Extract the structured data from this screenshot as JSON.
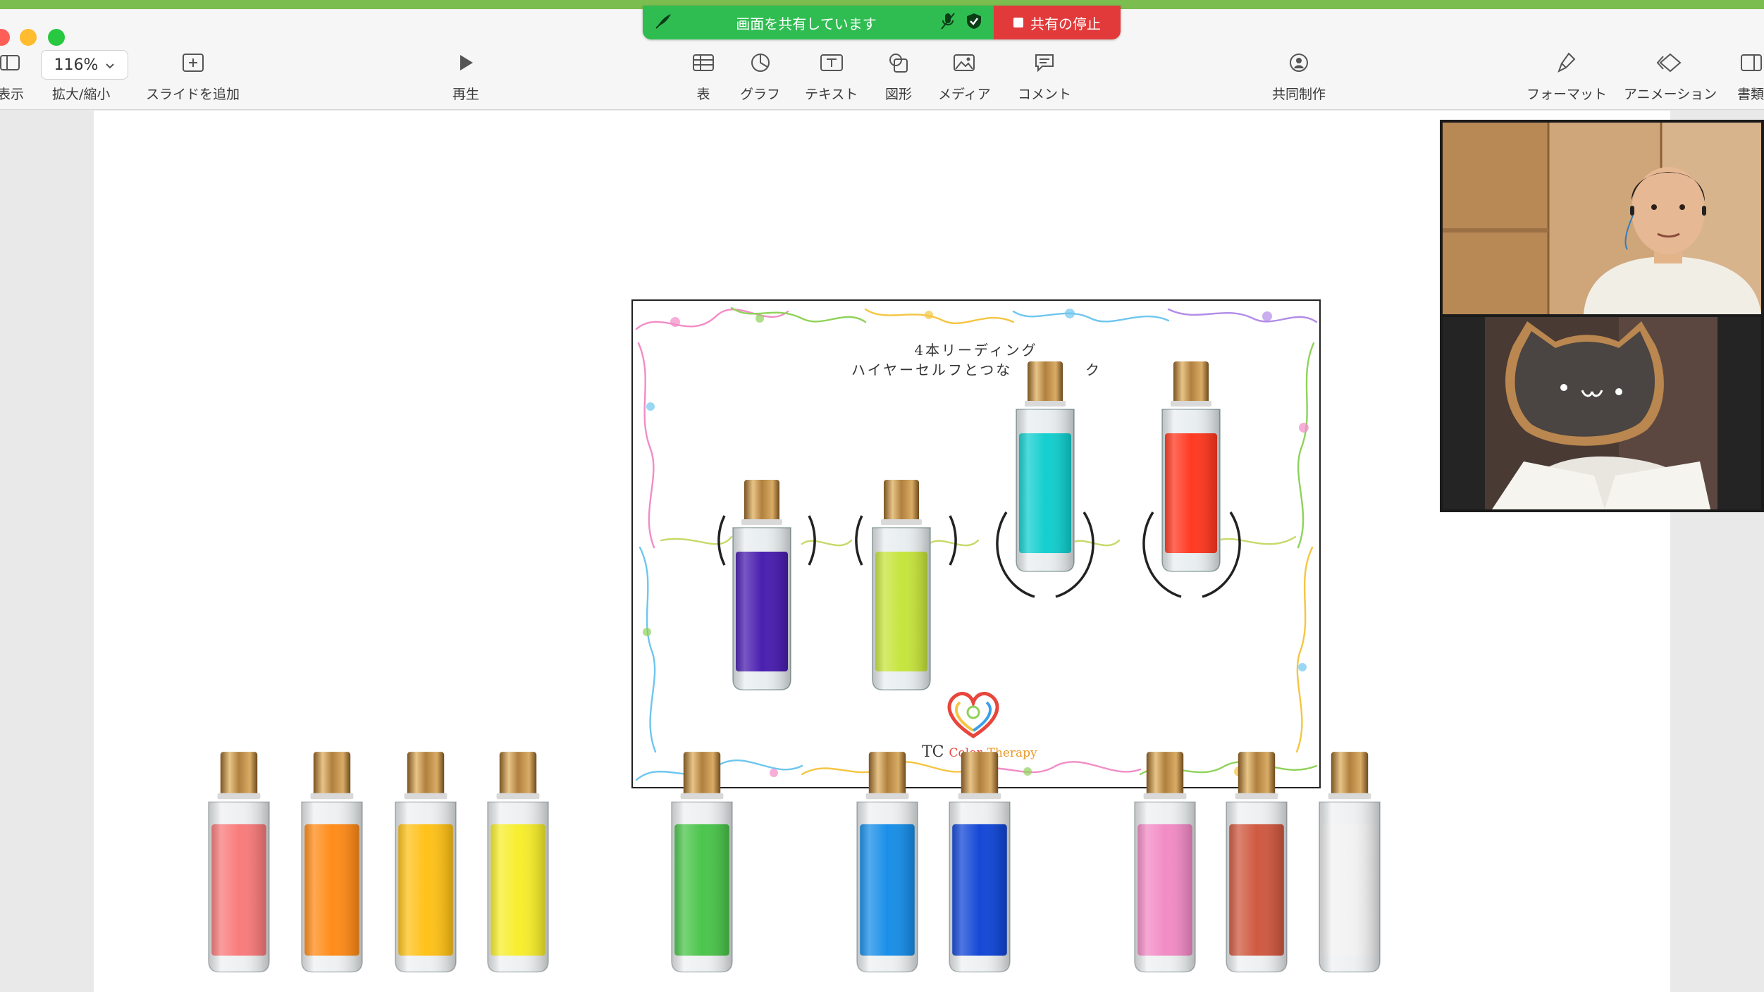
{
  "toolbar": {
    "view_label": "表示",
    "zoom_value": "116%",
    "zoom_label": "拡大/縮小",
    "add_slide_label": "スライドを追加",
    "play_label": "再生",
    "table_label": "表",
    "chart_label": "グラフ",
    "text_label": "テキスト",
    "shape_label": "図形",
    "media_label": "メディア",
    "comment_label": "コメント",
    "collaborate_label": "共同制作",
    "format_label": "フォーマット",
    "animate_label": "アニメーション",
    "document_label": "書類"
  },
  "share_banner": {
    "status": "画面を共有しています",
    "stop_label": "共有の停止"
  },
  "slide": {
    "title_line1": "4本リーディング",
    "title_line2_left": "ハイヤーセルフとつな",
    "title_line2_right": "ク",
    "brand_tc": "TC",
    "brand_color": "Color",
    "brand_therapy": "Therapy",
    "slot_bottles": [
      "#4a1fb0",
      "#c6e53e",
      "#14cfcf",
      "#ff3a22"
    ]
  },
  "palette_bottles": [
    "#f97c7c",
    "#ff8c1a",
    "#ffc21a",
    "#f7ee2e",
    "#4cc54c",
    "#1a8fe8",
    "#1448d6",
    "#f28cc6",
    "#d05a42",
    "#f2f2f2"
  ],
  "colors": {
    "share_green": "#2fbd52",
    "share_red": "#e23a3a",
    "bottle_cap": "#c8944a"
  }
}
